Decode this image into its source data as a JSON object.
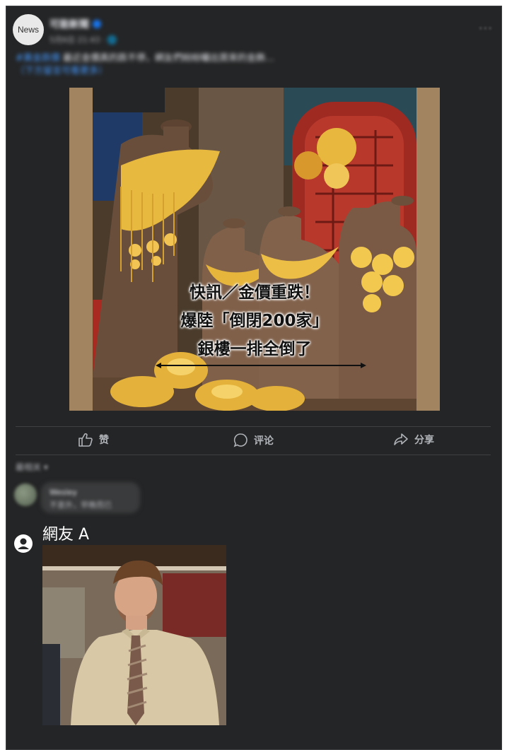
{
  "post": {
    "avatar_text": "News",
    "author": "可能新聞",
    "meta": "5月6日 21:43 · 🌐",
    "more": "···",
    "text_hashtag": "#黃金跌價",
    "text": " 最近金價真的跌不停，網友們紛紛曬出買來的金飾…",
    "link": "（下方留言可看更多）"
  },
  "post_image": {
    "overlay_lines": [
      "快訊／金價重跌！",
      "爆陸「倒閉200家」",
      "銀樓一排全倒了"
    ]
  },
  "actions": {
    "like": "赞",
    "comment": "评论",
    "share": "分享"
  },
  "comments": {
    "sort_label": "最相关 ▾",
    "blurred_name": "Wesley",
    "blurred_text": "不意外，早晚而已",
    "commenter_name": "網友 A"
  },
  "colors": {
    "card_bg": "#242526",
    "text": "#e4e6eb",
    "muted": "#b0b3b8",
    "link": "#4599ff",
    "divider": "#3e4042"
  }
}
